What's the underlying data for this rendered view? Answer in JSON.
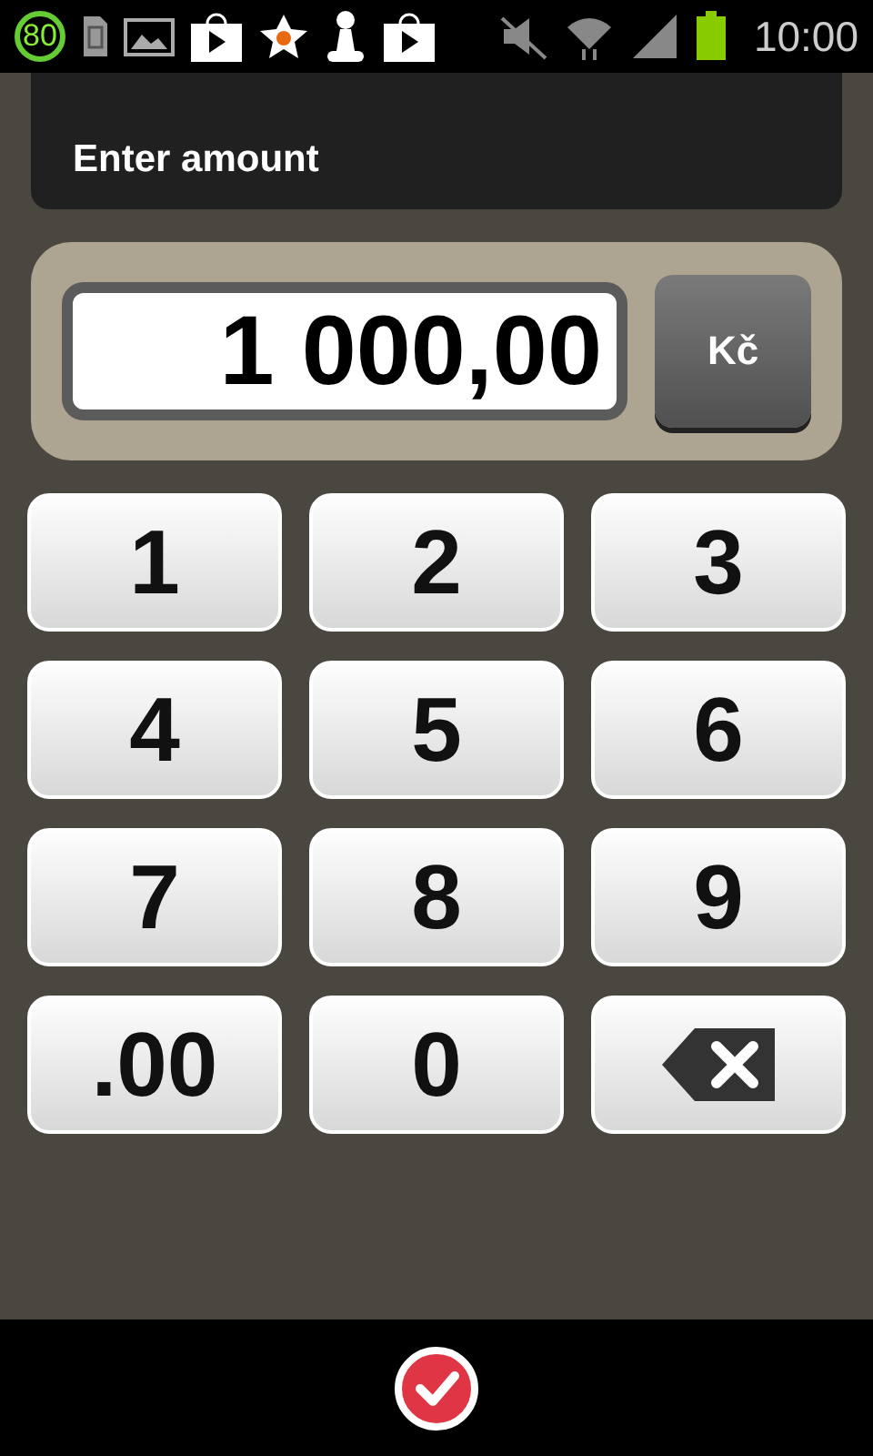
{
  "status_bar": {
    "battery_percent": "80",
    "time": "10:00"
  },
  "header": {
    "title": "Enter amount"
  },
  "display": {
    "value": "1 000,00",
    "currency": "Kč"
  },
  "keys": [
    {
      "label": "1",
      "kind": "digit"
    },
    {
      "label": "2",
      "kind": "digit"
    },
    {
      "label": "3",
      "kind": "digit"
    },
    {
      "label": "4",
      "kind": "digit"
    },
    {
      "label": "5",
      "kind": "digit"
    },
    {
      "label": "6",
      "kind": "digit"
    },
    {
      "label": "7",
      "kind": "digit"
    },
    {
      "label": "8",
      "kind": "digit"
    },
    {
      "label": "9",
      "kind": "digit"
    },
    {
      "label": ".00",
      "kind": "digit"
    },
    {
      "label": "0",
      "kind": "digit"
    },
    {
      "kind": "backspace"
    }
  ]
}
